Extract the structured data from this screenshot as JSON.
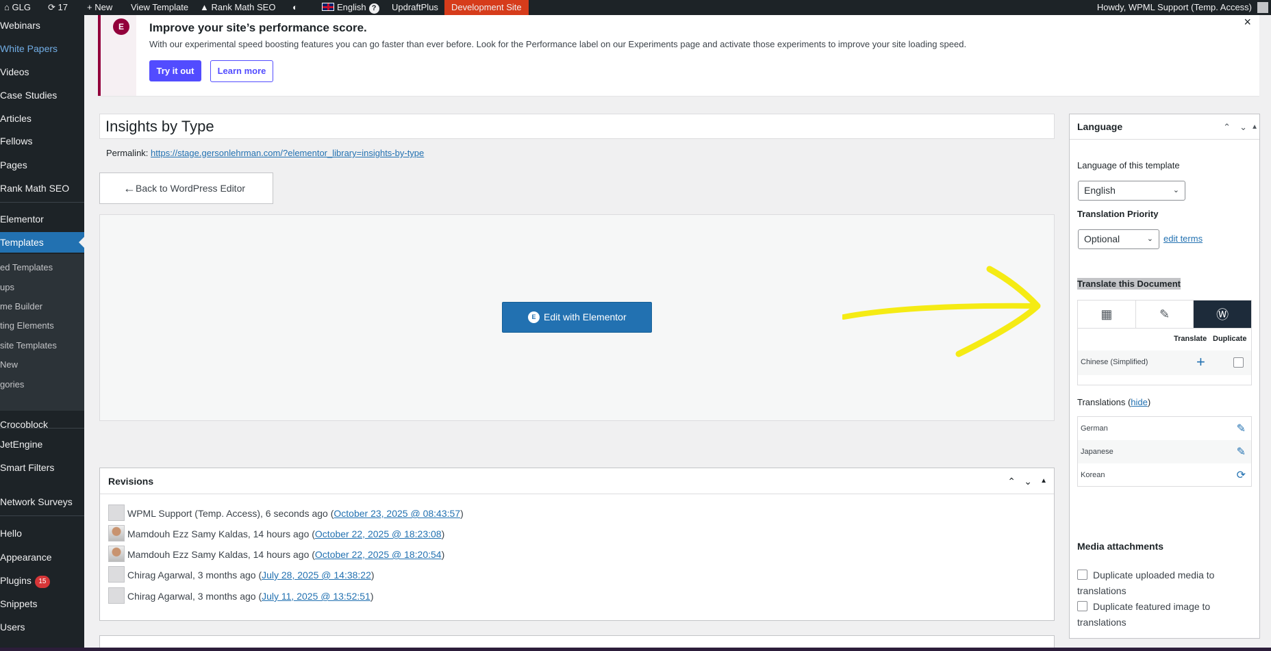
{
  "admin_bar": {
    "site_name": "GLG",
    "updates_count": "17",
    "new_label": "New",
    "view_template": "View Template",
    "rank_math": "Rank Math SEO",
    "language": "English",
    "updraft": "UpdraftPlus",
    "dev_site": "Development Site",
    "howdy": "Howdy, WPML Support (Temp. Access)"
  },
  "menu": {
    "webinars": "Webinars",
    "white_papers": "White Papers",
    "videos": "Videos",
    "case_studies": "Case Studies",
    "articles": "Articles",
    "fellows": "Fellows",
    "pages": "Pages",
    "rank_math": "Rank Math SEO",
    "elementor": "Elementor",
    "templates": "Templates",
    "sub_saved": "ed Templates",
    "sub_popups": "ups",
    "sub_theme": "me Builder",
    "sub_floating": "ting Elements",
    "sub_website": "site Templates",
    "sub_new": "New",
    "sub_categories": "gories",
    "crocoblock": "Crocoblock",
    "jetengine": "JetEngine",
    "smart_filters": "Smart Filters",
    "network_surveys": "Network Surveys",
    "hello": "Hello",
    "appearance": "Appearance",
    "plugins": "Plugins",
    "plugins_badge": "15",
    "snippets": "Snippets",
    "users": "Users"
  },
  "notice": {
    "title": "Improve your site’s performance score.",
    "text": "With our experimental speed boosting features you can go faster than ever before. Look for the Performance label on our Experiments page and activate those experiments to improve your site loading speed.",
    "try_label": "Try it out",
    "learn_label": "Learn more",
    "close": "×"
  },
  "editor": {
    "title": "Insights by Type",
    "permalink_label": "Permalink:",
    "permalink_url": "https://stage.gersonlehrman.com/?elementor_library=insights-by-type",
    "back_label": "Back to WordPress Editor",
    "edit_label": "Edit with Elementor"
  },
  "revisions": {
    "title": "Revisions",
    "rows": [
      {
        "who": "WPML Support (Temp. Access), 6 seconds ago (",
        "date": "October 23, 2025 @ 08:43:57",
        "end": ")"
      },
      {
        "who": "Mamdouh Ezz Samy Kaldas, 14 hours ago (",
        "date": "October 22, 2025 @ 18:23:08",
        "end": ")"
      },
      {
        "who": "Mamdouh Ezz Samy Kaldas, 14 hours ago (",
        "date": "October 22, 2025 @ 18:20:54",
        "end": ")"
      },
      {
        "who": "Chirag Agarwal, 3 months ago (",
        "date": "July 28, 2025 @ 14:38:22",
        "end": ")"
      },
      {
        "who": "Chirag Agarwal, 3 months ago (",
        "date": "July 11, 2025 @ 13:52:51",
        "end": ")"
      }
    ]
  },
  "language_box": {
    "title": "Language",
    "lang_label": "Language of this template",
    "lang_value": "English",
    "priority_label": "Translation Priority",
    "priority_value": "Optional",
    "edit_terms": "edit terms",
    "translate_doc": "Translate this Document",
    "col_translate": "Translate",
    "col_duplicate": "Duplicate",
    "pending_lang": "Chinese (Simplified)",
    "translations_label": "Translations",
    "hide_link": "hide",
    "translations": [
      "German",
      "Japanese",
      "Korean"
    ],
    "media_title": "Media attachments",
    "dup_media": "Duplicate uploaded media to translations",
    "dup_featured": "Duplicate featured image to translations"
  },
  "colors": {
    "admin_bg": "#1d2327",
    "accent": "#2271b1",
    "dev_site": "#d63c1b",
    "elementor": "#92003b",
    "annotation": "#f5eb14"
  }
}
